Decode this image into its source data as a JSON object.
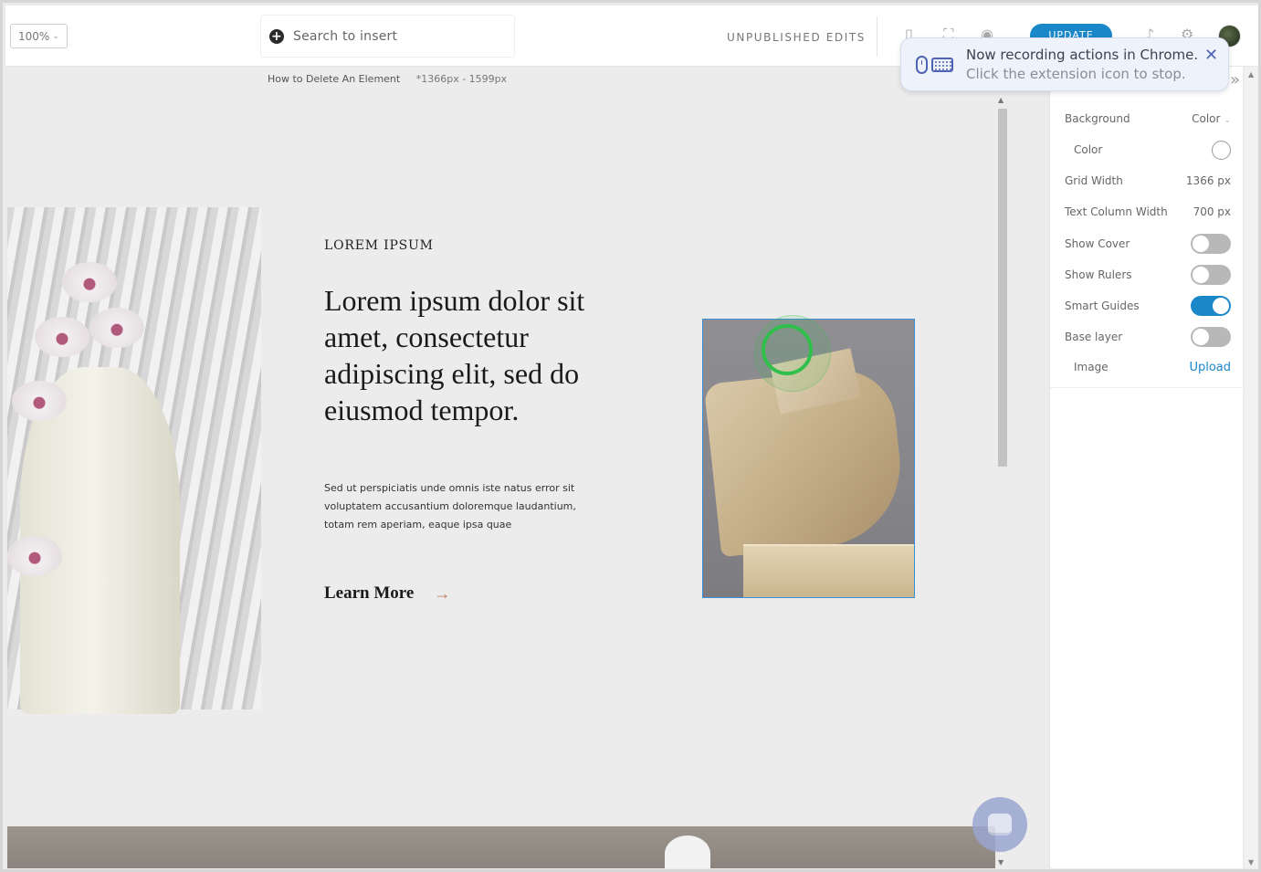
{
  "toolbar": {
    "zoom": "100%",
    "search_placeholder": "Search to insert",
    "status": "UNPUBLISHED EDITS",
    "update_label": "UPDATE"
  },
  "notification": {
    "title": "Now recording actions in Chrome.",
    "subtitle": "Click the extension icon to stop."
  },
  "subbar": {
    "page_name": "How to Delete An Element",
    "dimensions": "*1366px - 1599px"
  },
  "canvas": {
    "eyebrow": "LOREM IPSUM",
    "headline": "Lorem ipsum dolor sit amet, consectetur adipiscing elit, sed do eiusmod tempor.",
    "body": "Sed ut perspiciatis unde omnis iste natus error sit voluptatem accusantium doloremque laudantium, totam rem aperiam, eaque ipsa quae",
    "cta_label": "Learn More",
    "cta_arrow": "→"
  },
  "panel": {
    "background_label": "Background",
    "background_value": "Color",
    "color_label": "Color",
    "grid_width_label": "Grid Width",
    "grid_width_value": "1366 px",
    "text_column_label": "Text Column Width",
    "text_column_value": "700 px",
    "show_cover_label": "Show Cover",
    "show_cover_on": false,
    "show_rulers_label": "Show Rulers",
    "show_rulers_on": false,
    "smart_guides_label": "Smart Guides",
    "smart_guides_on": true,
    "base_layer_label": "Base layer",
    "base_layer_on": false,
    "image_label": "Image",
    "upload_label": "Upload"
  },
  "colors": {
    "accent": "#1a87c9",
    "recording_ring": "#2fbf4a",
    "cta_arrow": "#c0795c"
  }
}
